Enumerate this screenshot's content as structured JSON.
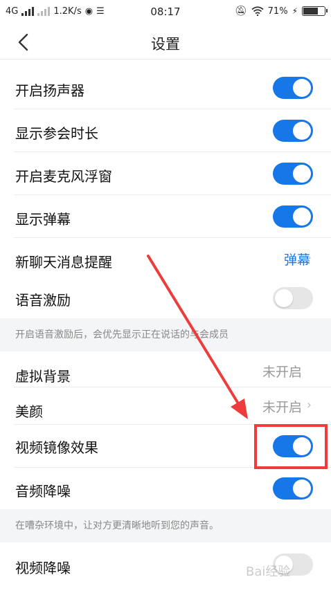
{
  "status": {
    "network": "4G",
    "speed": "1.2K/s",
    "time": "08:17",
    "battery": "71%",
    "battery_level": 0.71
  },
  "header": {
    "title": "设置"
  },
  "rows": {
    "speaker": {
      "label": "开启扬声器",
      "on": true
    },
    "duration": {
      "label": "显示参会时长",
      "on": true
    },
    "mic_float": {
      "label": "开启麦克风浮窗",
      "on": true
    },
    "danmaku": {
      "label": "显示弹幕",
      "on": true
    },
    "new_msg": {
      "label": "新聊天消息提醒",
      "value": "弹幕"
    },
    "voice_excite": {
      "label": "语音激励",
      "on": false
    },
    "virtual_bg": {
      "label": "虚拟背景",
      "value": "未开启"
    },
    "beauty": {
      "label": "美颜",
      "value": "未开启"
    },
    "mirror": {
      "label": "视频镜像效果",
      "on": true
    },
    "audio_nr": {
      "label": "音频降噪",
      "on": true
    },
    "video_nr": {
      "label": "视频降噪",
      "on": false
    }
  },
  "notes": {
    "voice_excite": "开启语音激励后，会优先显示正在说话的与会成员",
    "audio_nr": "在嘈杂环境中，让对方更清晰地听到您的声音。"
  },
  "watermark": "Bai经验",
  "colors": {
    "accent": "#1677e8",
    "annotation": "#ee3b3b"
  }
}
